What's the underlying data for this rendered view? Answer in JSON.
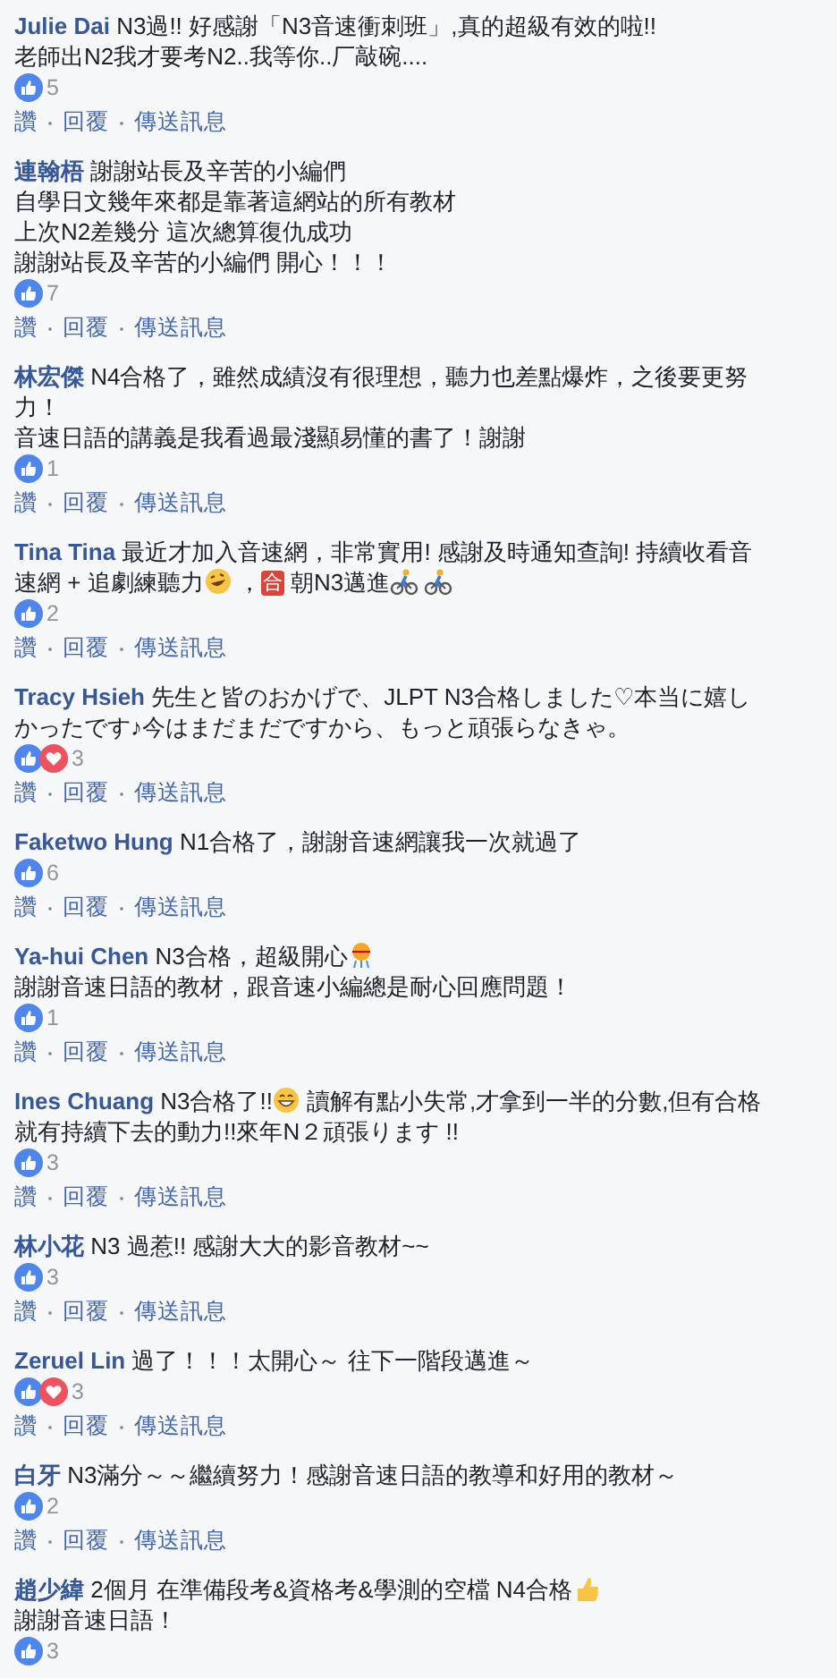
{
  "comments": [
    {
      "author": "Julie Dai",
      "lines": [
        [
          " N3過!! 好感謝「N3音速衝刺班」,真的超級有效的啦!!"
        ],
        [
          "老師出N2我才要考N2..我等你..厂敲碗...."
        ]
      ],
      "reactions": [
        {
          "kind": "like"
        }
      ],
      "count": "5",
      "actions": [
        "讚",
        "回覆",
        "傳送訊息"
      ]
    },
    {
      "author": "連翰梧",
      "lines": [
        [
          " 謝謝站長及辛苦的小編們"
        ],
        [
          "自學日文幾年來都是靠著這網站的所有教材"
        ],
        [
          "上次N2差幾分 這次總算復仇成功"
        ],
        [
          "謝謝站長及辛苦的小編們 開心！！！"
        ]
      ],
      "reactions": [
        {
          "kind": "like"
        }
      ],
      "count": "7",
      "actions": [
        "讚",
        "回覆",
        "傳送訊息"
      ]
    },
    {
      "author": "林宏傑",
      "lines": [
        [
          " N4合格了，雖然成績沒有很理想，聽力也差點爆炸，之後要更努"
        ],
        [
          "力！"
        ],
        [
          "音速日語的講義是我看過最淺顯易懂的書了！謝謝"
        ]
      ],
      "reactions": [
        {
          "kind": "like"
        }
      ],
      "count": "1",
      "actions": [
        "讚",
        "回覆",
        "傳送訊息"
      ]
    },
    {
      "author": "Tina Tina",
      "lines": [
        [
          " 最近才加入音速網，非常實用! 感謝及時通知查詢! 持續收看音"
        ],
        [
          "速網 + 追劇練聽力",
          {
            "kind": "laugh"
          },
          "，",
          {
            "kind": "badge",
            "text": "合"
          },
          " 朝N3邁進",
          {
            "kind": "bike"
          },
          {
            "kind": "bike"
          }
        ]
      ],
      "reactions": [
        {
          "kind": "like"
        }
      ],
      "count": "2",
      "actions": [
        "讚",
        "回覆",
        "傳送訊息"
      ]
    },
    {
      "author": "Tracy Hsieh",
      "lines": [
        [
          " 先生と皆のおかげで、JLPT N3合格しました♡本当に嬉し"
        ],
        [
          "かったです♪今はまだまだですから、もっと頑張らなきゃ。"
        ]
      ],
      "reactions": [
        {
          "kind": "like"
        },
        {
          "kind": "love"
        }
      ],
      "count": "3",
      "actions": [
        "讚",
        "回覆",
        "傳送訊息"
      ]
    },
    {
      "author": "Faketwo Hung",
      "lines": [
        [
          " N1合格了，謝謝音速網讓我一次就過了"
        ]
      ],
      "reactions": [
        {
          "kind": "like"
        }
      ],
      "count": "6",
      "actions": [
        "讚",
        "回覆",
        "傳送訊息"
      ]
    },
    {
      "author": "Ya-hui Chen",
      "lines": [
        [
          " N3合格，超級開心",
          {
            "kind": "confetti"
          }
        ],
        [
          "謝謝音速日語的教材，跟音速小編總是耐心回應問題！"
        ]
      ],
      "reactions": [
        {
          "kind": "like"
        }
      ],
      "count": "1",
      "actions": [
        "讚",
        "回覆",
        "傳送訊息"
      ]
    },
    {
      "author": "Ines Chuang",
      "lines": [
        [
          " N3合格了!!",
          {
            "kind": "grin"
          },
          "讀解有點小失常,才拿到一半的分數,但有合格"
        ],
        [
          "就有持續下去的動力!!來年N２頑張ります !!"
        ]
      ],
      "reactions": [
        {
          "kind": "like"
        }
      ],
      "count": "3",
      "actions": [
        "讚",
        "回覆",
        "傳送訊息"
      ]
    },
    {
      "author": "林小花",
      "lines": [
        [
          " N3 過惹!! 感謝大大的影音教材~~"
        ]
      ],
      "reactions": [
        {
          "kind": "like"
        }
      ],
      "count": "3",
      "actions": [
        "讚",
        "回覆",
        "傳送訊息"
      ]
    },
    {
      "author": "Zeruel Lin",
      "lines": [
        [
          " 過了！！！太開心～ 往下一階段邁進～"
        ]
      ],
      "reactions": [
        {
          "kind": "like"
        },
        {
          "kind": "love"
        }
      ],
      "count": "3",
      "actions": [
        "讚",
        "回覆",
        "傳送訊息"
      ]
    },
    {
      "author": "白牙",
      "lines": [
        [
          " N3滿分～～繼續努力！感謝音速日語的教導和好用的教材～"
        ]
      ],
      "reactions": [
        {
          "kind": "like"
        }
      ],
      "count": "2",
      "actions": [
        "讚",
        "回覆",
        "傳送訊息"
      ]
    },
    {
      "author": "趙少緯",
      "lines": [
        [
          " 2個月 在準備段考&資格考&學測的空檔 N4合格",
          {
            "kind": "thumb"
          }
        ],
        [
          "謝謝音速日語！"
        ]
      ],
      "reactions": [
        {
          "kind": "like"
        }
      ],
      "count": "3"
    }
  ]
}
